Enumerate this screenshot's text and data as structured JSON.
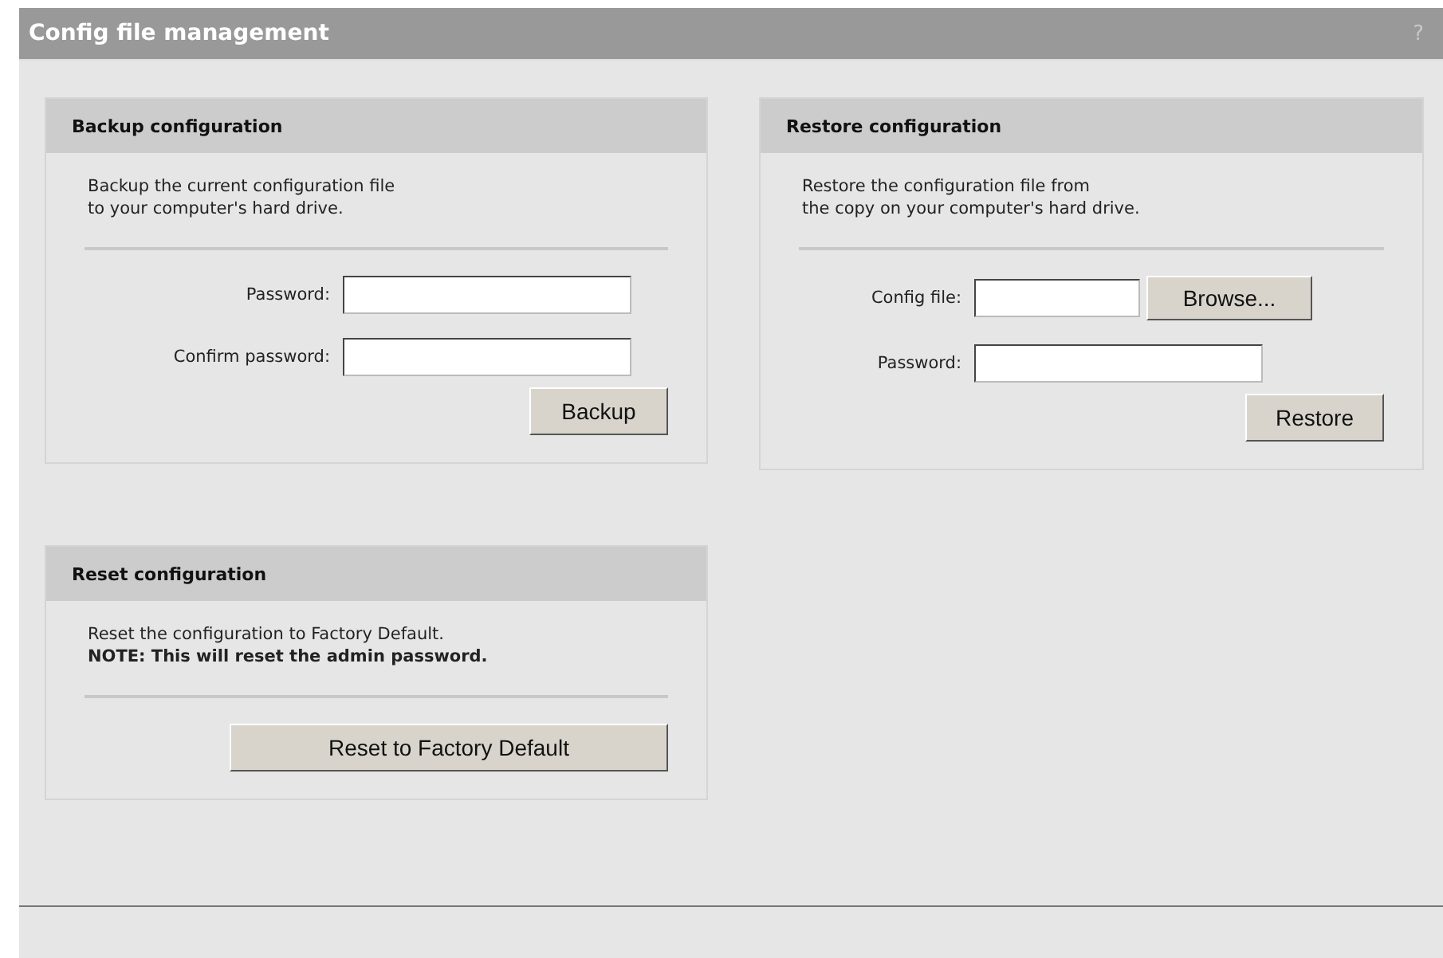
{
  "window": {
    "title": "Config file management",
    "help": "?"
  },
  "panels": [
    {
      "title": "Backup configuration",
      "description": [
        {
          "text": "Backup the current configuration file",
          "bold": false
        },
        {
          "text": "to your computer's hard drive.",
          "bold": false
        }
      ],
      "fields": [
        {
          "label": "Password:",
          "kind": "text"
        },
        {
          "label": "Confirm password:",
          "kind": "text"
        }
      ],
      "button": "Backup",
      "wide": false
    },
    {
      "title": "Restore configuration",
      "description": [
        {
          "text": "Restore the configuration file from",
          "bold": false
        },
        {
          "text": "the copy on your computer's hard drive.",
          "bold": false
        }
      ],
      "fields": [
        {
          "label": "Config file:",
          "kind": "file",
          "button": "Browse..."
        },
        {
          "label": "Password:",
          "kind": "text"
        }
      ],
      "button": "Restore",
      "wide": false
    },
    {
      "title": "Reset configuration",
      "description": [
        {
          "text": "Reset the configuration to Factory Default.",
          "bold": false
        },
        {
          "text": "NOTE: This will reset the admin password.",
          "bold": true
        }
      ],
      "button": "Reset to Factory Default",
      "wide": true
    }
  ]
}
